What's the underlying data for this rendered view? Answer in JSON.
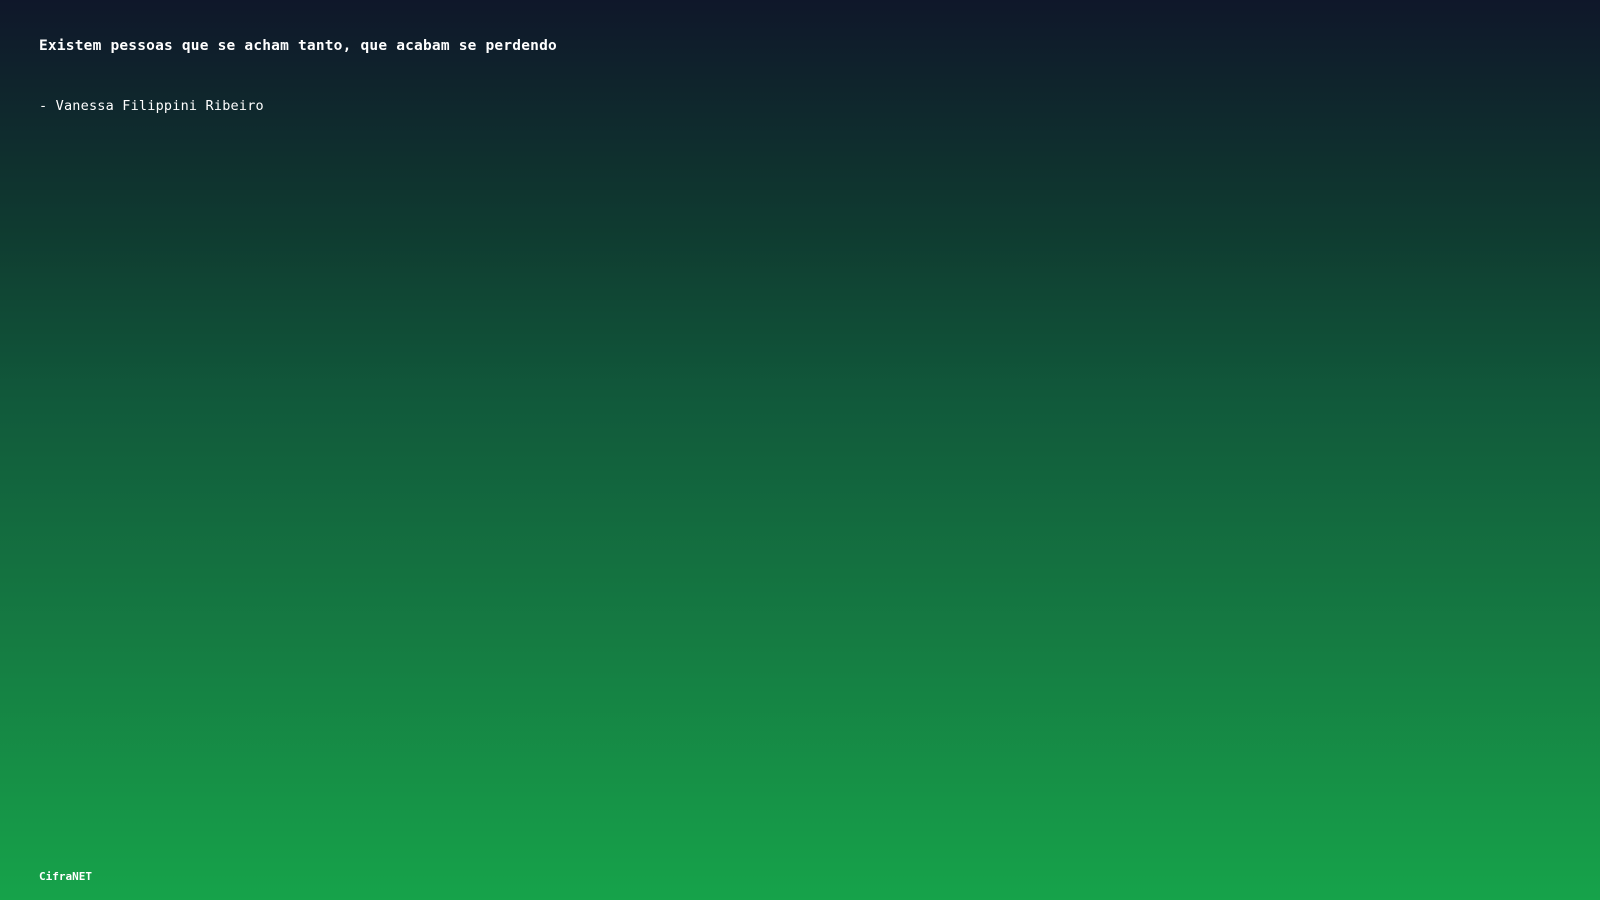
{
  "quote": {
    "text": "Existem pessoas que se acham tanto, que acabam se perdendo",
    "author": "- Vanessa Filippini Ribeiro"
  },
  "brand": {
    "name": "CifraNET"
  },
  "colors": {
    "gradient_top": "#0f172a",
    "gradient_bottom": "#16a34a",
    "text": "#ffffff"
  }
}
